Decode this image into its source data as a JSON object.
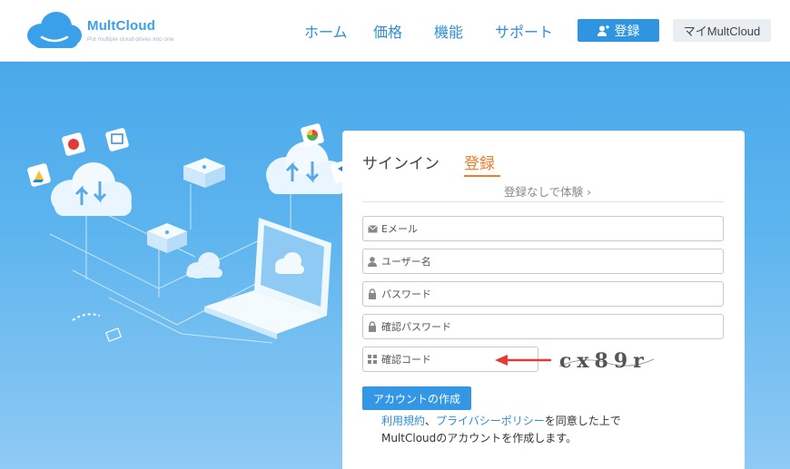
{
  "header": {
    "logo_name": "MultCloud",
    "logo_tagline": "Put multiple cloud drives into one",
    "nav": [
      "ホーム",
      "価格",
      "機能",
      "サポート"
    ],
    "register_button": "登録",
    "my_button": "マイMultCloud"
  },
  "form": {
    "tab_signin": "サインイン",
    "tab_register": "登録",
    "trial_link": "登録なしで体験 ›",
    "fields": {
      "email_placeholder": "Eメール",
      "username_placeholder": "ユーザー名",
      "password_placeholder": "パスワード",
      "confirm_password_placeholder": "確認パスワード",
      "captcha_placeholder": "確認コード"
    },
    "captcha_text": "cx89r",
    "create_button": "アカウントの作成",
    "terms": {
      "link1": "利用規約",
      "sep": "、",
      "link2": "プライバシーポリシー",
      "suffix": "を同意した上で",
      "line2": "MultCloudのアカウントを作成します。"
    }
  },
  "colors": {
    "accent_blue": "#2f95e0",
    "accent_orange": "#f07b2a",
    "arrow_red": "#e53935"
  }
}
